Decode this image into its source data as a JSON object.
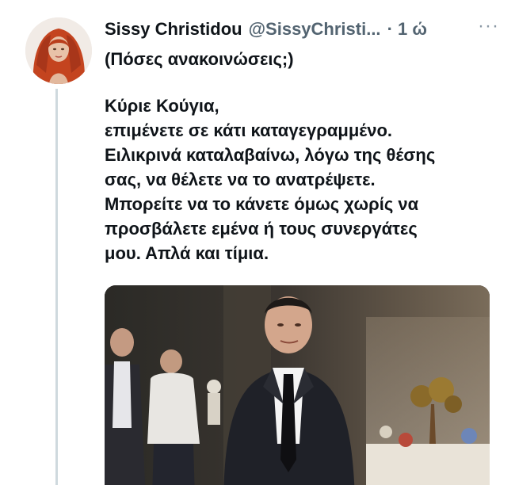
{
  "tweet": {
    "author_name": "Sissy Christidou",
    "handle": "@SissyChristi...",
    "time": "· 1 ώ",
    "more_icon": "more-horizontal-icon",
    "replying_context": "(Πόσες ανακοινώσεις;)",
    "body_lines": [
      "Κύριε Κούγια,",
      "επιμένετε σε κάτι καταγεγραμμένο.",
      "Ειλικρινά καταλαβαίνω, λόγω της θέσης",
      "σας, να θέλετε να το ανατρέψετε.",
      "Μπορείτε να το κάνετε όμως χωρίς να",
      "προσβάλετε εμένα ή τους συνεργάτες",
      "μου. Απλά και τίμια."
    ]
  },
  "colors": {
    "text": "#0f1419",
    "secondary": "#536471",
    "thread_line": "#cfd9de"
  }
}
